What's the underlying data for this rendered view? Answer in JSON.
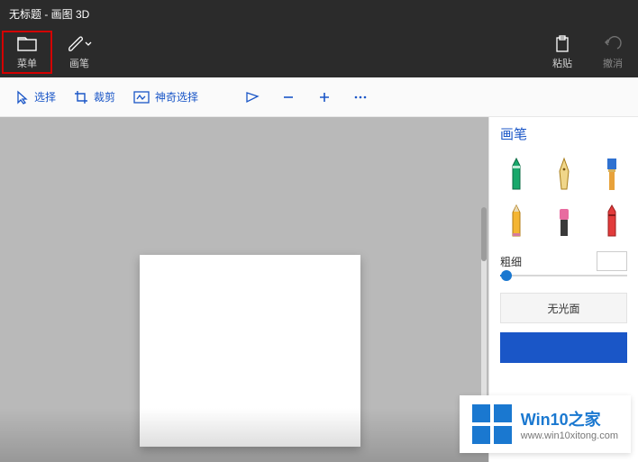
{
  "title": "无标题 - 画图 3D",
  "topbar": {
    "menu": "菜单",
    "brush": "画笔",
    "paste": "粘贴",
    "undo": "撤消"
  },
  "toolbar": {
    "select": "选择",
    "crop": "裁剪",
    "magic_select": "神奇选择"
  },
  "sidepanel": {
    "title": "画笔",
    "thickness_label": "粗细",
    "matte_btn": "无光面"
  },
  "watermark": {
    "brand_prefix": "Win10",
    "brand_suffix": "之家",
    "url": "www.win10xitong.com"
  }
}
